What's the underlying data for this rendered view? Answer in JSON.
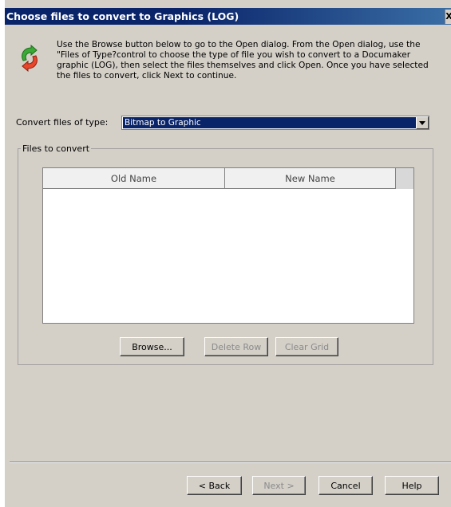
{
  "window": {
    "title": "Choose files to convert to Graphics (LOG)",
    "close_glyph": "X"
  },
  "logo_icon": "convert-arrows-icon",
  "instructions": "Use the Browse button below to go to the Open dialog.  From the Open dialog, use the \"Files of Type?control to choose the type of file you wish to convert to a Documaker graphic (LOG), then select the files themselves and click Open.  Once you have selected the files to convert, click Next to continue.",
  "convert_type": {
    "label": "Convert files of type:",
    "selected": "Bitmap to Graphic"
  },
  "files_group": {
    "legend": "Files to convert",
    "columns": [
      "Old Name",
      "New Name"
    ],
    "rows": []
  },
  "grid_buttons": {
    "browse": "Browse...",
    "delete_row": "Delete Row",
    "clear_grid": "Clear Grid"
  },
  "wizard_buttons": {
    "back": "< Back",
    "next": "Next >",
    "cancel": "Cancel",
    "help": "Help"
  },
  "colors": {
    "titlebar": "#0a246a",
    "dialog_bg": "#d4d0c8",
    "selection": "#0a246a"
  }
}
